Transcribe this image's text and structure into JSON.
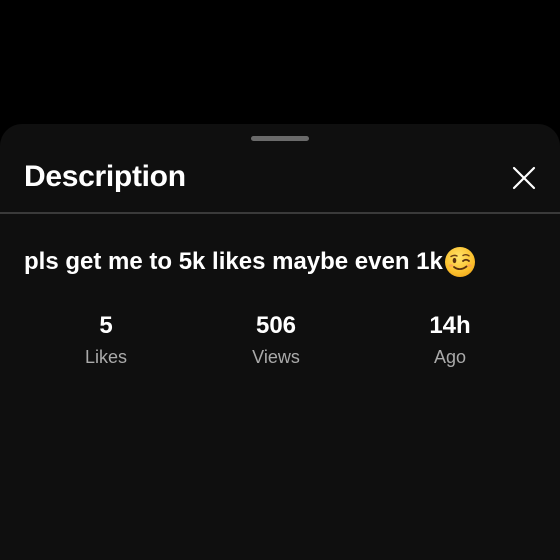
{
  "sheet": {
    "title": "Description",
    "close_icon": "close-icon",
    "description": "pls get me to 5k likes maybe even 1k",
    "description_emoji": "winking-face-emoji",
    "stats": [
      {
        "value": "5",
        "label": "Likes"
      },
      {
        "value": "506",
        "label": "Views"
      },
      {
        "value": "14h",
        "label": "Ago"
      }
    ]
  },
  "colors": {
    "background": "#000000",
    "sheet": "#0f0f0f",
    "text_primary": "#ffffff",
    "text_secondary": "#aaaaaa",
    "divider": "#3a3a3a",
    "handle": "#6a6a6a"
  }
}
